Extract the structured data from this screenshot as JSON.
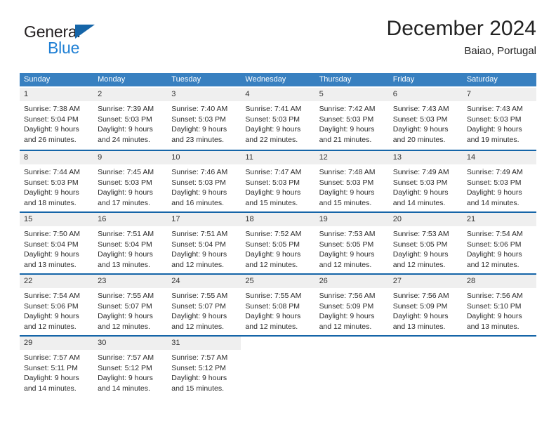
{
  "brand": {
    "name_top": "General",
    "name_bottom": "Blue",
    "triangle_color": "#1565a8",
    "blue_color": "#1e7fd4"
  },
  "header": {
    "title": "December 2024",
    "subtitle": "Baiao, Portugal"
  },
  "theme": {
    "header_row_bg": "#3880c0",
    "week_divider": "#1565a8",
    "day_number_bg": "#efefef",
    "text": "#2b2b2b"
  },
  "weekdays": [
    "Sunday",
    "Monday",
    "Tuesday",
    "Wednesday",
    "Thursday",
    "Friday",
    "Saturday"
  ],
  "weeks": [
    {
      "days": [
        {
          "number": "1",
          "sunrise": "Sunrise: 7:38 AM",
          "sunset": "Sunset: 5:04 PM",
          "daylight1": "Daylight: 9 hours",
          "daylight2": "and 26 minutes."
        },
        {
          "number": "2",
          "sunrise": "Sunrise: 7:39 AM",
          "sunset": "Sunset: 5:03 PM",
          "daylight1": "Daylight: 9 hours",
          "daylight2": "and 24 minutes."
        },
        {
          "number": "3",
          "sunrise": "Sunrise: 7:40 AM",
          "sunset": "Sunset: 5:03 PM",
          "daylight1": "Daylight: 9 hours",
          "daylight2": "and 23 minutes."
        },
        {
          "number": "4",
          "sunrise": "Sunrise: 7:41 AM",
          "sunset": "Sunset: 5:03 PM",
          "daylight1": "Daylight: 9 hours",
          "daylight2": "and 22 minutes."
        },
        {
          "number": "5",
          "sunrise": "Sunrise: 7:42 AM",
          "sunset": "Sunset: 5:03 PM",
          "daylight1": "Daylight: 9 hours",
          "daylight2": "and 21 minutes."
        },
        {
          "number": "6",
          "sunrise": "Sunrise: 7:43 AM",
          "sunset": "Sunset: 5:03 PM",
          "daylight1": "Daylight: 9 hours",
          "daylight2": "and 20 minutes."
        },
        {
          "number": "7",
          "sunrise": "Sunrise: 7:43 AM",
          "sunset": "Sunset: 5:03 PM",
          "daylight1": "Daylight: 9 hours",
          "daylight2": "and 19 minutes."
        }
      ]
    },
    {
      "days": [
        {
          "number": "8",
          "sunrise": "Sunrise: 7:44 AM",
          "sunset": "Sunset: 5:03 PM",
          "daylight1": "Daylight: 9 hours",
          "daylight2": "and 18 minutes."
        },
        {
          "number": "9",
          "sunrise": "Sunrise: 7:45 AM",
          "sunset": "Sunset: 5:03 PM",
          "daylight1": "Daylight: 9 hours",
          "daylight2": "and 17 minutes."
        },
        {
          "number": "10",
          "sunrise": "Sunrise: 7:46 AM",
          "sunset": "Sunset: 5:03 PM",
          "daylight1": "Daylight: 9 hours",
          "daylight2": "and 16 minutes."
        },
        {
          "number": "11",
          "sunrise": "Sunrise: 7:47 AM",
          "sunset": "Sunset: 5:03 PM",
          "daylight1": "Daylight: 9 hours",
          "daylight2": "and 15 minutes."
        },
        {
          "number": "12",
          "sunrise": "Sunrise: 7:48 AM",
          "sunset": "Sunset: 5:03 PM",
          "daylight1": "Daylight: 9 hours",
          "daylight2": "and 15 minutes."
        },
        {
          "number": "13",
          "sunrise": "Sunrise: 7:49 AM",
          "sunset": "Sunset: 5:03 PM",
          "daylight1": "Daylight: 9 hours",
          "daylight2": "and 14 minutes."
        },
        {
          "number": "14",
          "sunrise": "Sunrise: 7:49 AM",
          "sunset": "Sunset: 5:03 PM",
          "daylight1": "Daylight: 9 hours",
          "daylight2": "and 14 minutes."
        }
      ]
    },
    {
      "days": [
        {
          "number": "15",
          "sunrise": "Sunrise: 7:50 AM",
          "sunset": "Sunset: 5:04 PM",
          "daylight1": "Daylight: 9 hours",
          "daylight2": "and 13 minutes."
        },
        {
          "number": "16",
          "sunrise": "Sunrise: 7:51 AM",
          "sunset": "Sunset: 5:04 PM",
          "daylight1": "Daylight: 9 hours",
          "daylight2": "and 13 minutes."
        },
        {
          "number": "17",
          "sunrise": "Sunrise: 7:51 AM",
          "sunset": "Sunset: 5:04 PM",
          "daylight1": "Daylight: 9 hours",
          "daylight2": "and 12 minutes."
        },
        {
          "number": "18",
          "sunrise": "Sunrise: 7:52 AM",
          "sunset": "Sunset: 5:05 PM",
          "daylight1": "Daylight: 9 hours",
          "daylight2": "and 12 minutes."
        },
        {
          "number": "19",
          "sunrise": "Sunrise: 7:53 AM",
          "sunset": "Sunset: 5:05 PM",
          "daylight1": "Daylight: 9 hours",
          "daylight2": "and 12 minutes."
        },
        {
          "number": "20",
          "sunrise": "Sunrise: 7:53 AM",
          "sunset": "Sunset: 5:05 PM",
          "daylight1": "Daylight: 9 hours",
          "daylight2": "and 12 minutes."
        },
        {
          "number": "21",
          "sunrise": "Sunrise: 7:54 AM",
          "sunset": "Sunset: 5:06 PM",
          "daylight1": "Daylight: 9 hours",
          "daylight2": "and 12 minutes."
        }
      ]
    },
    {
      "days": [
        {
          "number": "22",
          "sunrise": "Sunrise: 7:54 AM",
          "sunset": "Sunset: 5:06 PM",
          "daylight1": "Daylight: 9 hours",
          "daylight2": "and 12 minutes."
        },
        {
          "number": "23",
          "sunrise": "Sunrise: 7:55 AM",
          "sunset": "Sunset: 5:07 PM",
          "daylight1": "Daylight: 9 hours",
          "daylight2": "and 12 minutes."
        },
        {
          "number": "24",
          "sunrise": "Sunrise: 7:55 AM",
          "sunset": "Sunset: 5:07 PM",
          "daylight1": "Daylight: 9 hours",
          "daylight2": "and 12 minutes."
        },
        {
          "number": "25",
          "sunrise": "Sunrise: 7:55 AM",
          "sunset": "Sunset: 5:08 PM",
          "daylight1": "Daylight: 9 hours",
          "daylight2": "and 12 minutes."
        },
        {
          "number": "26",
          "sunrise": "Sunrise: 7:56 AM",
          "sunset": "Sunset: 5:09 PM",
          "daylight1": "Daylight: 9 hours",
          "daylight2": "and 12 minutes."
        },
        {
          "number": "27",
          "sunrise": "Sunrise: 7:56 AM",
          "sunset": "Sunset: 5:09 PM",
          "daylight1": "Daylight: 9 hours",
          "daylight2": "and 13 minutes."
        },
        {
          "number": "28",
          "sunrise": "Sunrise: 7:56 AM",
          "sunset": "Sunset: 5:10 PM",
          "daylight1": "Daylight: 9 hours",
          "daylight2": "and 13 minutes."
        }
      ]
    },
    {
      "days": [
        {
          "number": "29",
          "sunrise": "Sunrise: 7:57 AM",
          "sunset": "Sunset: 5:11 PM",
          "daylight1": "Daylight: 9 hours",
          "daylight2": "and 14 minutes."
        },
        {
          "number": "30",
          "sunrise": "Sunrise: 7:57 AM",
          "sunset": "Sunset: 5:12 PM",
          "daylight1": "Daylight: 9 hours",
          "daylight2": "and 14 minutes."
        },
        {
          "number": "31",
          "sunrise": "Sunrise: 7:57 AM",
          "sunset": "Sunset: 5:12 PM",
          "daylight1": "Daylight: 9 hours",
          "daylight2": "and 15 minutes."
        },
        {
          "number": "",
          "sunrise": "",
          "sunset": "",
          "daylight1": "",
          "daylight2": ""
        },
        {
          "number": "",
          "sunrise": "",
          "sunset": "",
          "daylight1": "",
          "daylight2": ""
        },
        {
          "number": "",
          "sunrise": "",
          "sunset": "",
          "daylight1": "",
          "daylight2": ""
        },
        {
          "number": "",
          "sunrise": "",
          "sunset": "",
          "daylight1": "",
          "daylight2": ""
        }
      ]
    }
  ]
}
